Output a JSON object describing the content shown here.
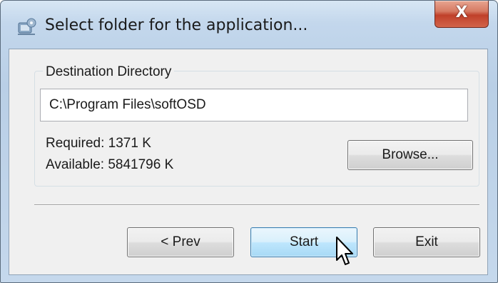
{
  "window": {
    "title": "Select folder for the application...",
    "close_label": "X"
  },
  "group": {
    "legend": "Destination Directory",
    "path_value": "C:\\Program Files\\softOSD",
    "required": "Required: 1371 K",
    "available": "Available: 5841796 K",
    "browse_label": "Browse..."
  },
  "footer": {
    "prev_label": "< Prev",
    "start_label": "Start",
    "exit_label": "Exit"
  },
  "colors": {
    "close_button": "#c0402a",
    "hover_button": "#bee6fd"
  }
}
